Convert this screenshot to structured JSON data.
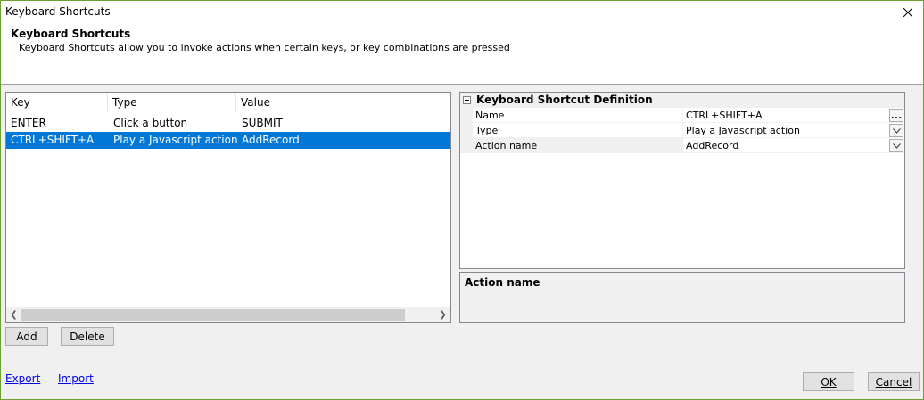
{
  "window": {
    "title": "Keyboard Shortcuts"
  },
  "header": {
    "title": "Keyboard Shortcuts",
    "description": "Keyboard Shortcuts allow you to invoke actions when certain keys, or key combinations are pressed"
  },
  "list": {
    "columns": [
      "Key",
      "Type",
      "Value"
    ],
    "rows": [
      {
        "key": "ENTER",
        "type": "Click a button",
        "value": "SUBMIT",
        "selected": false
      },
      {
        "key": "CTRL+SHIFT+A",
        "type": "Play a Javascript action",
        "value": "AddRecord",
        "selected": true
      }
    ]
  },
  "buttons": {
    "add": "Add",
    "delete": "Delete",
    "ok": "OK",
    "cancel": "Cancel"
  },
  "links": {
    "export": "Export",
    "import": "Import"
  },
  "property_grid": {
    "category": "Keyboard Shortcut Definition",
    "rows": [
      {
        "name": "Name",
        "value": "CTRL+SHIFT+A",
        "button": "..."
      },
      {
        "name": "Type",
        "value": "Play a Javascript action",
        "button": "chevron-down"
      },
      {
        "name": "Action name",
        "value": "AddRecord",
        "button": "chevron-down"
      }
    ]
  },
  "help": {
    "title": "Action name"
  },
  "colors": {
    "selection": "#0078d7",
    "window_border": "#6aa130"
  }
}
